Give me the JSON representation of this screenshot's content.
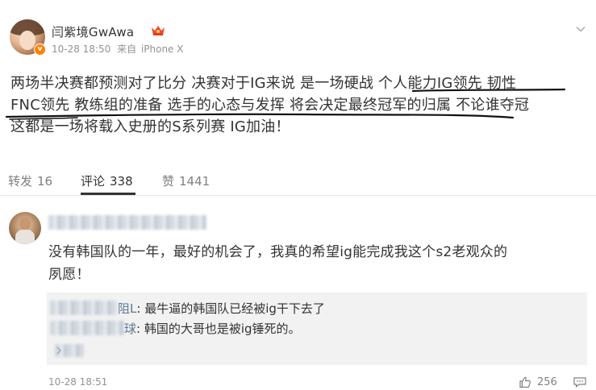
{
  "post": {
    "author": "闫紫境GwAwa",
    "time": "10-28 18:50",
    "source_prefix": "来自",
    "source": "iPhone X",
    "text_lines": [
      "两场半决赛都预测对了比分 决赛对于IG来说 是一场硬战 个人能力IG领先 韧性",
      "FNC领先 教练组的准备 选手的心态与发挥 将会决定最终冠军的归属 不论谁夺冠",
      "这都是一场将载入史册的S系列赛 IG加油！"
    ]
  },
  "actions": {
    "repost_label": "转发",
    "repost_count": "16",
    "comment_label": "评论",
    "comment_count": "338",
    "like_label": "赞",
    "like_count": "1441"
  },
  "comment": {
    "text_lines": [
      "没有韩国队的一年，最好的机会了，我真的希望ig能完成我这个s2老观众的",
      "夙愿！"
    ],
    "replies": [
      {
        "author_tail": "阻L",
        "separator": ":",
        "text": "最牛逼的韩国队已经被ig干下去了"
      },
      {
        "author_tail": "球",
        "separator": ":",
        "text": "韩国的大哥也是被ig锤死的。"
      }
    ],
    "time": "10-28 18:51",
    "like_count": "256"
  },
  "icons": {
    "verified": "verified-v-icon",
    "vip": "vip-crown-icon",
    "menu": "chevron-down-icon",
    "like": "thumbs-up-icon",
    "more": "more-dots-icon",
    "reply_arrow": "chevron-right-icon"
  },
  "colors": {
    "verified": "#ff8200",
    "link": "#5d7895",
    "meta": "#939393",
    "reply_bg": "#f2f2f2"
  }
}
